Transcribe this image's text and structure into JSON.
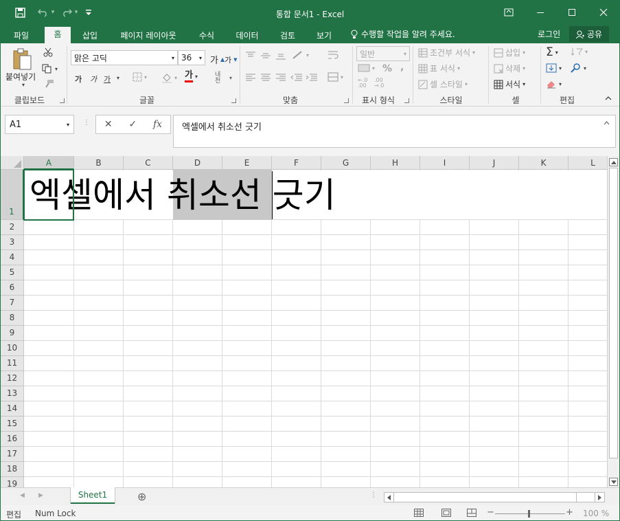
{
  "window": {
    "title": "통합 문서1 - Excel",
    "controls": {
      "ribbon_display": "▣",
      "minimize": "─",
      "maximize": "☐",
      "close": "✕"
    }
  },
  "quick_access": {
    "save": "💾",
    "undo": "↶",
    "redo": "↷",
    "customize": "▾"
  },
  "tabs": [
    {
      "label": "파일"
    },
    {
      "label": "홈"
    },
    {
      "label": "삽입"
    },
    {
      "label": "페이지 레이아웃"
    },
    {
      "label": "수식"
    },
    {
      "label": "데이터"
    },
    {
      "label": "검토"
    },
    {
      "label": "보기"
    }
  ],
  "active_tab": "홈",
  "tell_me": "수행할 작업을 알려 주세요.",
  "account": {
    "login": "로그인",
    "share": "공유"
  },
  "ribbon": {
    "clipboard": {
      "paste": "붙여넣기",
      "label": "클립보드"
    },
    "font": {
      "name": "맑은 고딕",
      "size": "36",
      "grow": "가",
      "shrink": "가",
      "bold": "가",
      "italic": "가",
      "underline": "가",
      "font_color_glyph": "가",
      "phonetic": "내천",
      "label": "글꼴"
    },
    "alignment": {
      "label": "맞춤"
    },
    "number": {
      "format": "일반",
      "percent": "%",
      "comma": ",",
      "label": "표시 형식"
    },
    "styles": {
      "conditional": "조건부 서식",
      "table": "표 서식",
      "cell": "셀 스타일",
      "label": "스타일"
    },
    "cells": {
      "insert": "삽입",
      "delete": "삭제",
      "format": "서식",
      "label": "셀"
    },
    "editing": {
      "sum": "Σ",
      "label": "편집"
    }
  },
  "formula_bar": {
    "name_box": "A1",
    "cancel": "✕",
    "enter": "✓",
    "fx": "fx",
    "content": "엑셀에서 취소선 긋기"
  },
  "sheet": {
    "columns": [
      "A",
      "B",
      "C",
      "D",
      "E",
      "F",
      "G",
      "H",
      "I",
      "J",
      "K",
      "L"
    ],
    "rows": [
      "1",
      "2",
      "3",
      "4",
      "5",
      "6",
      "7",
      "8",
      "9",
      "10",
      "11",
      "12",
      "13",
      "14",
      "15",
      "16",
      "17",
      "18",
      "19"
    ],
    "cell_a1": "엑셀에서 취소선 긋기"
  },
  "sheet_tabs": [
    {
      "label": "Sheet1"
    }
  ],
  "add_sheet": "⊕",
  "status": {
    "mode": "편집",
    "num_lock": "Num Lock",
    "zoom": "100 %"
  },
  "colors": {
    "accent": "#217346",
    "highlight": "#c8c8c8"
  }
}
